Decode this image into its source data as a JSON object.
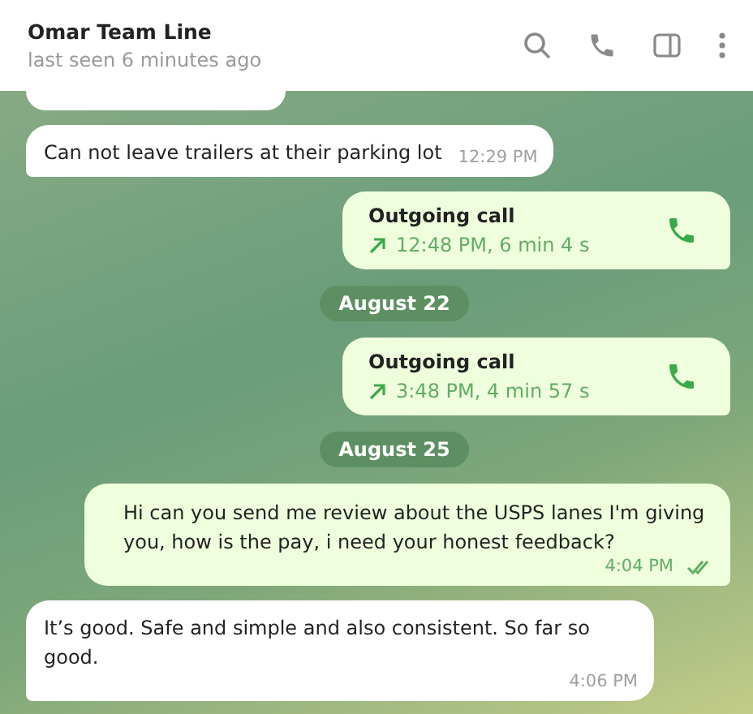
{
  "header": {
    "title": "Omar Team Line",
    "status": "last seen 6 minutes ago"
  },
  "messages": [
    {
      "kind": "partial",
      "outgoing": false
    },
    {
      "kind": "text",
      "outgoing": false,
      "text": "Can not leave trailers at their parking lot",
      "time": "12:29 PM"
    },
    {
      "kind": "call",
      "outgoing": true,
      "title": "Outgoing call",
      "details": "12:48 PM, 6 min 4 s"
    },
    {
      "kind": "date",
      "text": "August 22"
    },
    {
      "kind": "call",
      "outgoing": true,
      "title": "Outgoing call",
      "details": "3:48 PM, 4 min 57 s"
    },
    {
      "kind": "date",
      "text": "August 25"
    },
    {
      "kind": "text",
      "outgoing": true,
      "text": "Hi can you send me review about the USPS lanes I'm giving you, how is the pay, i need your honest feedback?",
      "time": "4:04 PM",
      "read": true
    },
    {
      "kind": "text",
      "outgoing": false,
      "text": "It’s good. Safe and simple and also consistent. So far so good.",
      "time": "4:06 PM"
    }
  ]
}
